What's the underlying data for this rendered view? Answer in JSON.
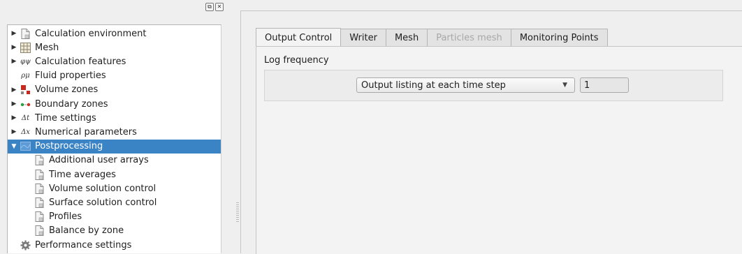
{
  "dock": {
    "title_buttons": [
      {
        "icon": "float-icon",
        "glyph": "⧉"
      },
      {
        "icon": "close-icon",
        "glyph": "✕"
      }
    ],
    "tree": [
      {
        "label": "Calculation environment",
        "expander": "▶",
        "icon": "document-icon",
        "level": 0
      },
      {
        "label": "Mesh",
        "expander": "▶",
        "icon": "grid-icon",
        "level": 0
      },
      {
        "label": "Calculation features",
        "expander": "▶",
        "icon": "phi-psi-icon",
        "icon_text": "φψ",
        "level": 0
      },
      {
        "label": "Fluid properties",
        "expander": "",
        "icon": "rho-mu-icon",
        "icon_text": "ρμ",
        "level": 0
      },
      {
        "label": "Volume zones",
        "expander": "▶",
        "icon": "volume-zones-icon",
        "level": 0
      },
      {
        "label": "Boundary zones",
        "expander": "▶",
        "icon": "boundary-zones-icon",
        "level": 0
      },
      {
        "label": "Time settings",
        "expander": "▶",
        "icon": "delta-t-icon",
        "icon_text": "Δt",
        "level": 0
      },
      {
        "label": "Numerical parameters",
        "expander": "▶",
        "icon": "delta-x-icon",
        "icon_text": "Δx",
        "level": 0
      },
      {
        "label": "Postprocessing",
        "expander": "▼",
        "icon": "postprocessing-icon",
        "level": 0,
        "selected": true
      },
      {
        "label": "Additional user arrays",
        "expander": "",
        "icon": "document-icon",
        "level": 1
      },
      {
        "label": "Time averages",
        "expander": "",
        "icon": "document-icon",
        "level": 1
      },
      {
        "label": "Volume solution control",
        "expander": "",
        "icon": "document-icon",
        "level": 1
      },
      {
        "label": "Surface solution control",
        "expander": "",
        "icon": "document-icon",
        "level": 1
      },
      {
        "label": "Profiles",
        "expander": "",
        "icon": "document-icon",
        "level": 1
      },
      {
        "label": "Balance by zone",
        "expander": "",
        "icon": "document-icon",
        "level": 1
      },
      {
        "label": "Performance settings",
        "expander": "",
        "icon": "gear-icon",
        "level": 0
      }
    ]
  },
  "tabs": [
    {
      "label": "Output Control",
      "state": "active"
    },
    {
      "label": "Writer",
      "state": "normal"
    },
    {
      "label": "Mesh",
      "state": "normal"
    },
    {
      "label": "Particles mesh",
      "state": "disabled"
    },
    {
      "label": "Monitoring Points",
      "state": "normal"
    }
  ],
  "output_control": {
    "group_title": "Log frequency",
    "listing_combo": {
      "value": "Output listing at each time step",
      "caret": "▼"
    },
    "frequency_value": "1"
  },
  "colors": {
    "selection": "#3a83c5",
    "background": "#efefef"
  }
}
